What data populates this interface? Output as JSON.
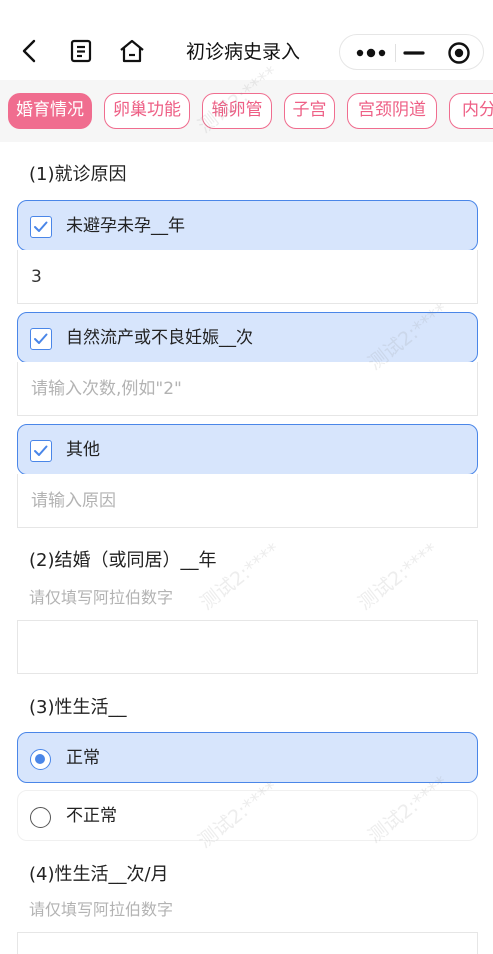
{
  "nav": {
    "title": "初诊病史录入",
    "back_icon": "chevron-left-icon",
    "doc_icon": "document-icon",
    "home_icon": "home-icon",
    "more_icon": "more-dots-icon",
    "minimize_icon": "minimize-icon",
    "target_icon": "target-icon"
  },
  "tabs": [
    {
      "label": "婚育情况",
      "active": true
    },
    {
      "label": "卵巢功能",
      "active": false
    },
    {
      "label": "输卵管",
      "active": false
    },
    {
      "label": "子宫",
      "active": false
    },
    {
      "label": "宫颈阴道",
      "active": false
    },
    {
      "label": "内分",
      "active": false
    }
  ],
  "q1": {
    "label": "(1)就诊原因",
    "options": [
      {
        "label": "未避孕未孕__年",
        "checked": true,
        "value": "3",
        "placeholder": ""
      },
      {
        "label": "自然流产或不良妊娠__次",
        "checked": true,
        "value": "",
        "placeholder": "请输入次数,例如\"2\""
      },
      {
        "label": "其他",
        "checked": true,
        "value": "",
        "placeholder": "请输入原因"
      }
    ]
  },
  "q2": {
    "label": "(2)结婚（或同居）__年",
    "hint": "请仅填写阿拉伯数字",
    "value": ""
  },
  "q3": {
    "label": "(3)性生活__",
    "options": [
      {
        "label": "正常",
        "selected": true
      },
      {
        "label": "不正常",
        "selected": false
      }
    ]
  },
  "q4": {
    "label": "(4)性生活__次/月",
    "hint": "请仅填写阿拉伯数字"
  },
  "watermark": "测试2:****",
  "colors": {
    "accent_pink": "#f06d8f",
    "accent_blue": "#4a86e8",
    "checked_bg": "#d7e5fc"
  }
}
